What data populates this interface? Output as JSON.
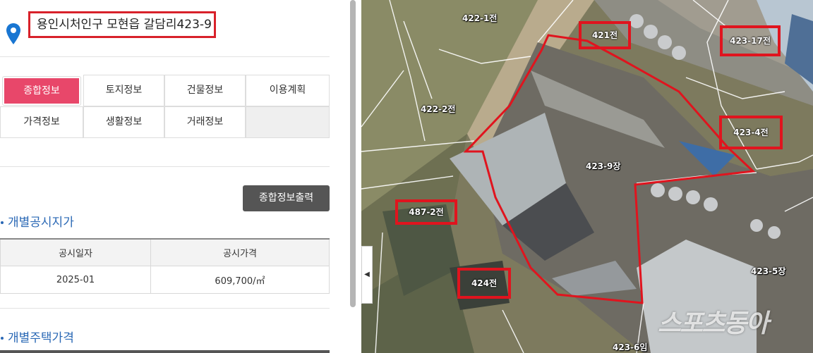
{
  "address": "용인시처인구 모현읍 갈담리423-9",
  "tabs": [
    {
      "label": "종합정보",
      "active": true
    },
    {
      "label": "토지정보"
    },
    {
      "label": "건물정보"
    },
    {
      "label": "이용계획"
    },
    {
      "label": "가격정보"
    },
    {
      "label": "생활정보"
    },
    {
      "label": "거래정보"
    }
  ],
  "print_button": "종합정보출력",
  "land_price": {
    "title": "개별공시지가",
    "headers": [
      "공시일자",
      "공시가격"
    ],
    "rows": [
      [
        "2025-01",
        "609,700/㎡"
      ]
    ]
  },
  "house_price": {
    "title": "개별주택가격"
  },
  "map": {
    "handle_glyph": "◀",
    "labels": [
      "422-1전",
      "422-2전",
      "423-9장",
      "423-5장",
      "423-6임"
    ],
    "boxed_labels": [
      "421전",
      "423-17전",
      "423-4전",
      "487-2전",
      "424전"
    ],
    "watermark": "스포츠동아",
    "accent_color": "#e0141e"
  }
}
